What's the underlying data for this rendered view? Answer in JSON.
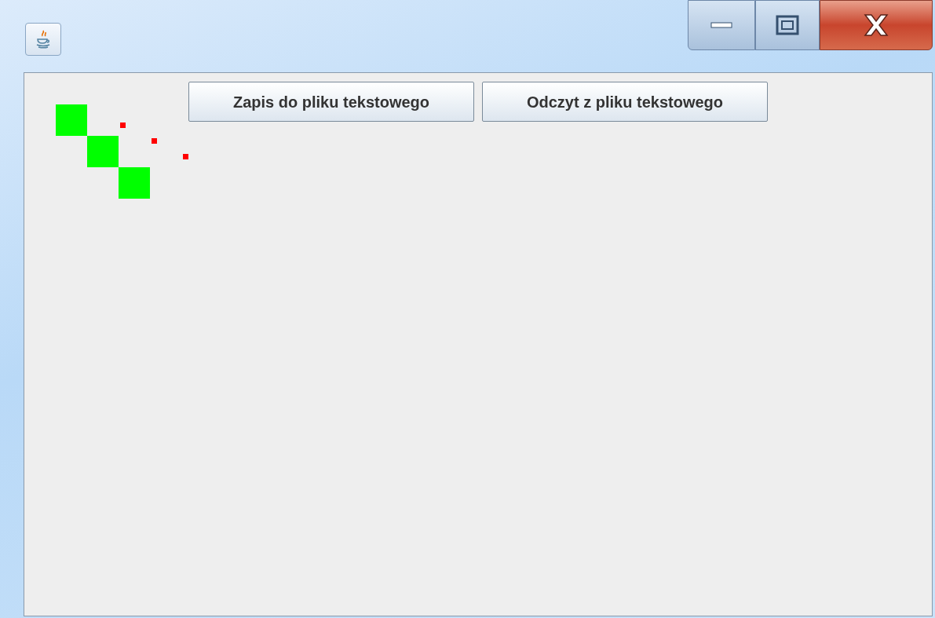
{
  "buttons": [
    {
      "label": "Zapis do pliku tekstowego"
    },
    {
      "label": "Odczyt z pliku tekstowego"
    }
  ]
}
